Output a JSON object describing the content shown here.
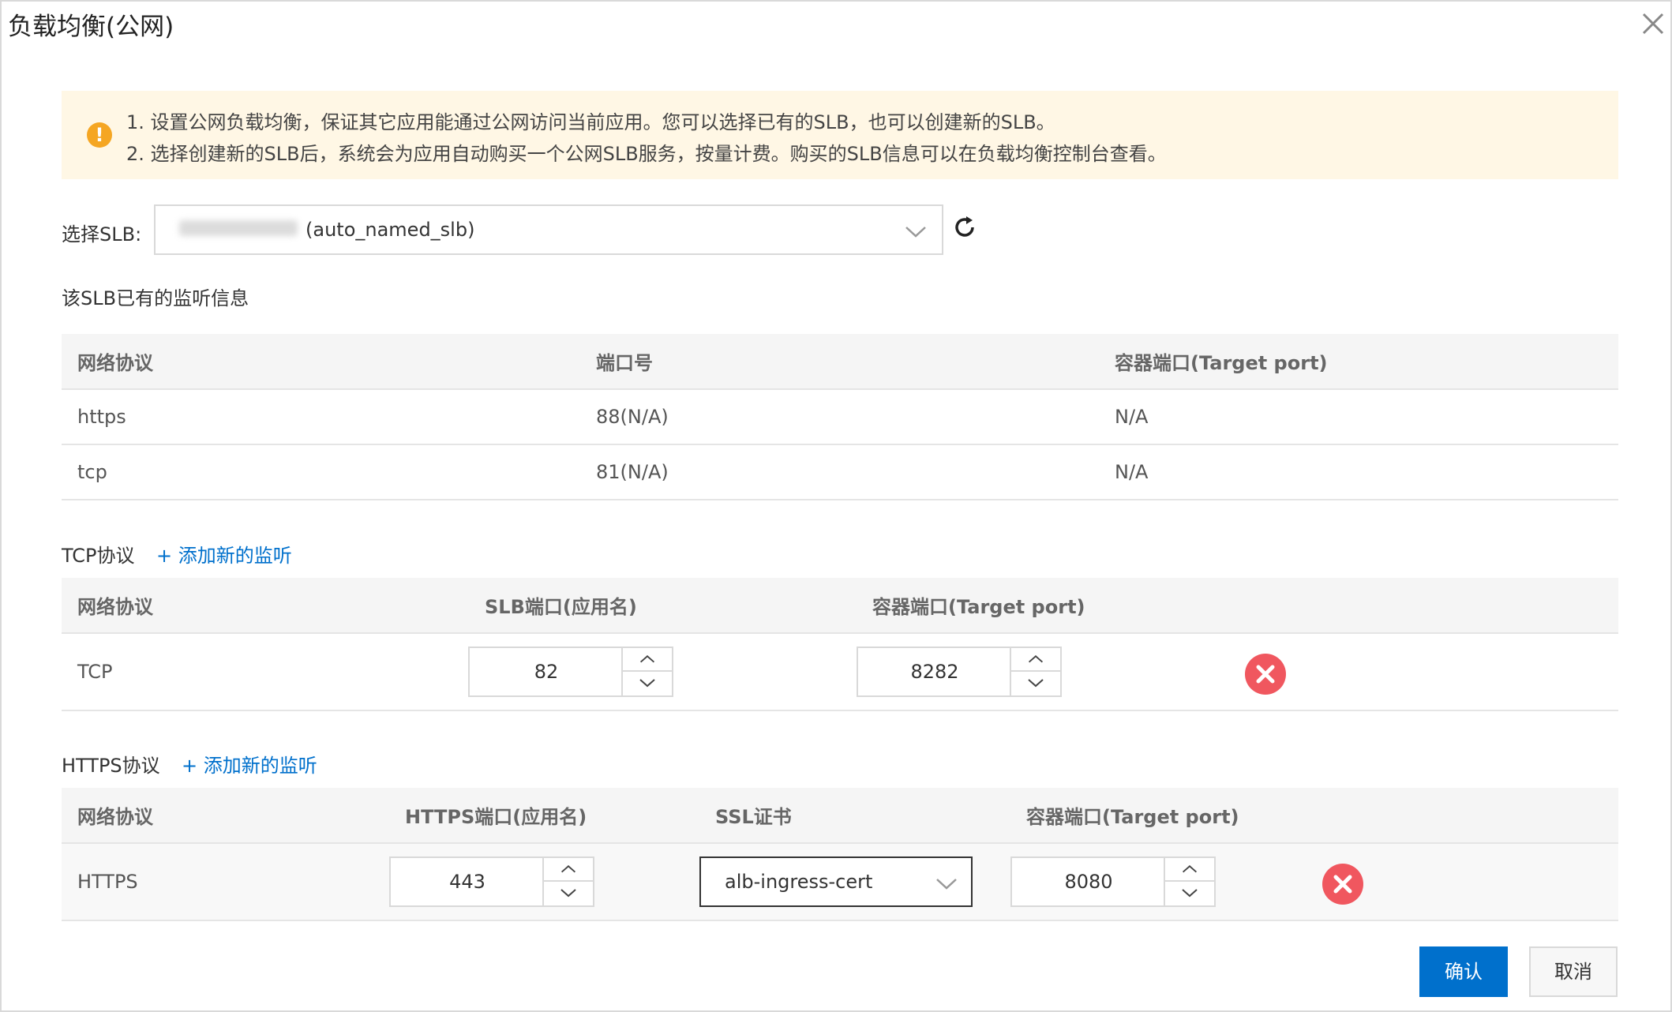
{
  "dialog": {
    "title": "负载均衡(公网)",
    "close_icon": "close-icon"
  },
  "notice": {
    "icon": "warning-icon",
    "line1": "1. 设置公网负载均衡，保证其它应用能通过公网访问当前应用。您可以选择已有的SLB，也可以创建新的SLB。",
    "line2": "2. 选择创建新的SLB后，系统会为应用自动购买一个公网SLB服务，按量计费。购买的SLB信息可以在负载均衡控制台查看。"
  },
  "slb_select": {
    "label": "选择SLB:",
    "value_suffix": "(auto_named_slb)",
    "refresh_icon": "refresh-icon"
  },
  "existing": {
    "title": "该SLB已有的监听信息",
    "columns": [
      "网络协议",
      "端口号",
      "容器端口(Target port)"
    ],
    "rows": [
      [
        "https",
        "88(N/A)",
        "N/A"
      ],
      [
        "tcp",
        "81(N/A)",
        "N/A"
      ]
    ]
  },
  "tcp": {
    "title": "TCP协议",
    "add_link": "+ 添加新的监听",
    "columns": [
      "网络协议",
      "SLB端口(应用名)",
      "容器端口(Target port)"
    ],
    "row": {
      "protocol": "TCP",
      "slb_port": "82",
      "target_port": "8282"
    }
  },
  "https": {
    "title": "HTTPS协议",
    "add_link": "+ 添加新的监听",
    "columns": [
      "网络协议",
      "HTTPS端口(应用名)",
      "SSL证书",
      "容器端口(Target port)"
    ],
    "row": {
      "protocol": "HTTPS",
      "https_port": "443",
      "ssl_cert": "alb-ingress-cert",
      "target_port": "8080"
    }
  },
  "footer": {
    "confirm": "确认",
    "cancel": "取消"
  },
  "colors": {
    "primary": "#0070cc",
    "notice_bg": "#fff7e5",
    "warning": "#f5a623",
    "delete": "#f0575f"
  }
}
